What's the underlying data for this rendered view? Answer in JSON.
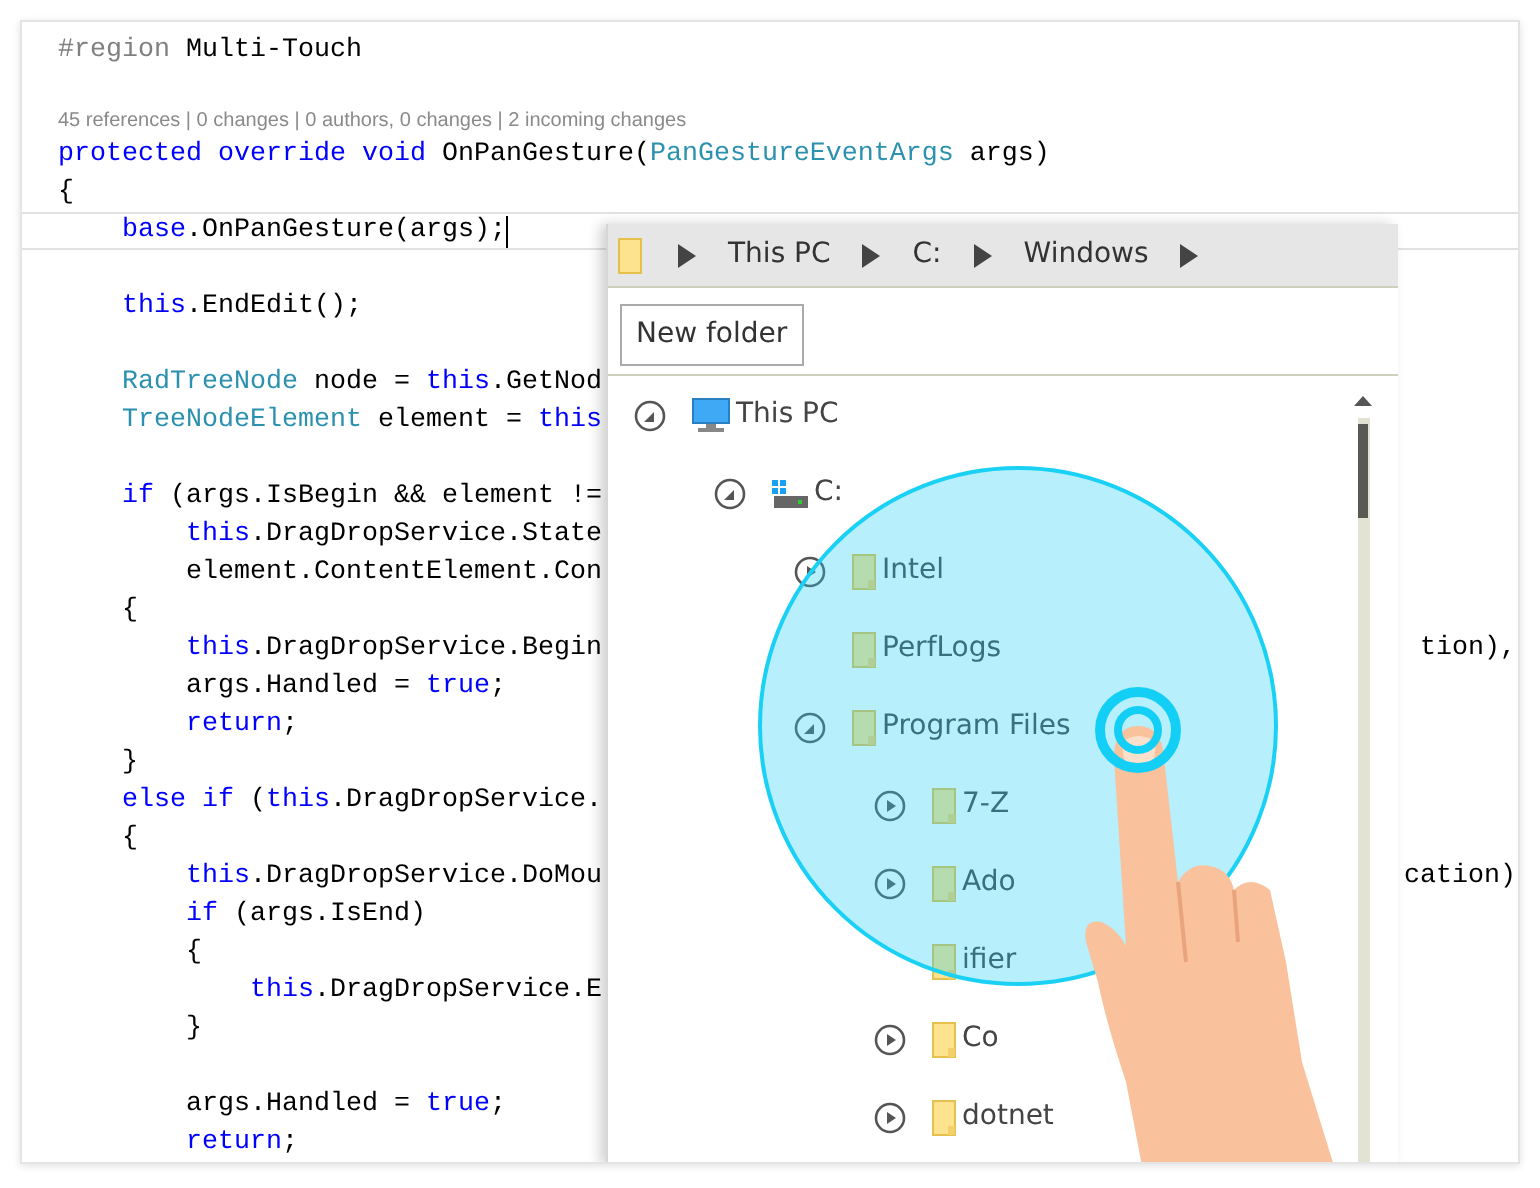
{
  "editor": {
    "lines": [
      {
        "kind": "code",
        "current": false,
        "segments": [
          {
            "kind": "dir",
            "text": "#region "
          },
          {
            "kind": "plain",
            "text": "Multi-Touch"
          }
        ]
      },
      {
        "kind": "codelens",
        "text": "45 references | 0 changes | 0 authors, 0 changes | 2 incoming changes"
      },
      {
        "kind": "code",
        "current": false,
        "segments": [
          {
            "kind": "kw",
            "text": "protected override void"
          },
          {
            "kind": "plain",
            "text": " OnPanGesture("
          },
          {
            "kind": "type",
            "text": "PanGestureEventArgs"
          },
          {
            "kind": "plain",
            "text": " args)"
          }
        ]
      },
      {
        "kind": "code",
        "current": false,
        "segments": [
          {
            "kind": "plain",
            "text": "{"
          }
        ]
      },
      {
        "kind": "code",
        "current": true,
        "segments": [
          {
            "kind": "kw",
            "text": "    base"
          },
          {
            "kind": "plain",
            "text": ".OnPanGesture(args);"
          }
        ]
      },
      {
        "kind": "blank"
      },
      {
        "kind": "code",
        "current": false,
        "segments": [
          {
            "kind": "kw",
            "text": "    this"
          },
          {
            "kind": "plain",
            "text": ".EndEdit();"
          }
        ]
      },
      {
        "kind": "blank"
      },
      {
        "kind": "code",
        "current": false,
        "segments": [
          {
            "kind": "type",
            "text": "    RadTreeNode"
          },
          {
            "kind": "plain",
            "text": " node = "
          },
          {
            "kind": "kw",
            "text": "this"
          },
          {
            "kind": "plain",
            "text": ".GetNod"
          }
        ]
      },
      {
        "kind": "code",
        "current": false,
        "segments": [
          {
            "kind": "type",
            "text": "    TreeNodeElement"
          },
          {
            "kind": "plain",
            "text": " element = "
          },
          {
            "kind": "kw",
            "text": "this"
          }
        ]
      },
      {
        "kind": "blank"
      },
      {
        "kind": "code",
        "current": false,
        "segments": [
          {
            "kind": "kw",
            "text": "    if"
          },
          {
            "kind": "plain",
            "text": " (args.IsBegin && element !="
          }
        ]
      },
      {
        "kind": "code",
        "current": false,
        "segments": [
          {
            "kind": "kw",
            "text": "        this"
          },
          {
            "kind": "plain",
            "text": ".DragDropService.State"
          }
        ]
      },
      {
        "kind": "code",
        "current": false,
        "segments": [
          {
            "kind": "plain",
            "text": "        element.ContentElement.Con"
          }
        ]
      },
      {
        "kind": "code",
        "current": false,
        "segments": [
          {
            "kind": "plain",
            "text": "    {"
          }
        ]
      },
      {
        "kind": "code",
        "current": false,
        "segments": [
          {
            "kind": "kw",
            "text": "        this"
          },
          {
            "kind": "plain",
            "text": ".DragDropService.Begin"
          }
        ],
        "right": "tion),"
      },
      {
        "kind": "code",
        "current": false,
        "segments": [
          {
            "kind": "plain",
            "text": "        args.Handled = "
          },
          {
            "kind": "kw",
            "text": "true"
          },
          {
            "kind": "plain",
            "text": ";"
          }
        ]
      },
      {
        "kind": "code",
        "current": false,
        "segments": [
          {
            "kind": "kw",
            "text": "        return"
          },
          {
            "kind": "plain",
            "text": ";"
          }
        ]
      },
      {
        "kind": "code",
        "current": false,
        "segments": [
          {
            "kind": "plain",
            "text": "    }"
          }
        ]
      },
      {
        "kind": "code",
        "current": false,
        "segments": [
          {
            "kind": "kw",
            "text": "    else if"
          },
          {
            "kind": "plain",
            "text": " ("
          },
          {
            "kind": "kw",
            "text": "this"
          },
          {
            "kind": "plain",
            "text": ".DragDropService."
          }
        ]
      },
      {
        "kind": "code",
        "current": false,
        "segments": [
          {
            "kind": "plain",
            "text": "    {"
          }
        ]
      },
      {
        "kind": "code",
        "current": false,
        "segments": [
          {
            "kind": "kw",
            "text": "        this"
          },
          {
            "kind": "plain",
            "text": ".DragDropService.DoMou"
          }
        ],
        "right": "cation)"
      },
      {
        "kind": "code",
        "current": false,
        "segments": [
          {
            "kind": "kw",
            "text": "        if"
          },
          {
            "kind": "plain",
            "text": " (args.IsEnd)"
          }
        ]
      },
      {
        "kind": "code",
        "current": false,
        "segments": [
          {
            "kind": "plain",
            "text": "        {"
          }
        ]
      },
      {
        "kind": "code",
        "current": false,
        "segments": [
          {
            "kind": "kw",
            "text": "            this"
          },
          {
            "kind": "plain",
            "text": ".DragDropService.E"
          }
        ]
      },
      {
        "kind": "code",
        "current": false,
        "segments": [
          {
            "kind": "plain",
            "text": "        }"
          }
        ]
      },
      {
        "kind": "blank"
      },
      {
        "kind": "code",
        "current": false,
        "segments": [
          {
            "kind": "plain",
            "text": "        args.Handled = "
          },
          {
            "kind": "kw",
            "text": "true"
          },
          {
            "kind": "plain",
            "text": ";"
          }
        ]
      },
      {
        "kind": "code",
        "current": false,
        "segments": [
          {
            "kind": "kw",
            "text": "        return"
          },
          {
            "kind": "plain",
            "text": ";"
          }
        ]
      }
    ]
  },
  "dialog": {
    "breadcrumb": [
      "This PC",
      "C:",
      "Windows"
    ],
    "new_folder_button": "New folder",
    "tree": [
      {
        "label": "This PC",
        "kind": "computer",
        "expanded": true,
        "children": [
          {
            "label": "C:",
            "kind": "drive",
            "expanded": true,
            "children": [
              {
                "label": "Intel",
                "kind": "folder",
                "expanded": false
              },
              {
                "label": "PerfLogs",
                "kind": "folder"
              },
              {
                "label": "Program Files",
                "kind": "folder",
                "expanded": true,
                "children": [
                  {
                    "label": "7-Z",
                    "kind": "folder",
                    "expanded": false
                  },
                  {
                    "label": "Ado",
                    "kind": "folder",
                    "expanded": false
                  },
                  {
                    "label": "ifier",
                    "kind": "folder"
                  },
                  {
                    "label": "Co",
                    "kind": "folder",
                    "expanded": false
                  },
                  {
                    "label": "dotnet",
                    "kind": "folder",
                    "expanded": false
                  }
                ]
              }
            ]
          }
        ]
      }
    ]
  }
}
